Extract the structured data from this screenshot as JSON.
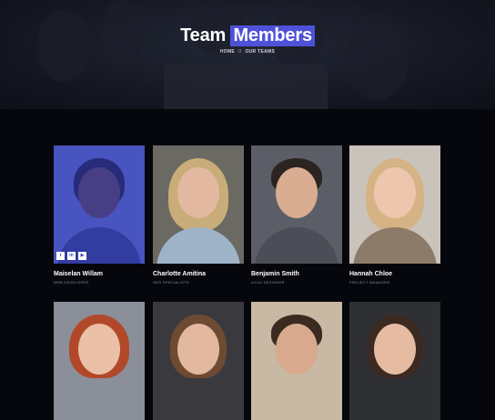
{
  "hero": {
    "title_a": "Team",
    "title_b": "Members",
    "breadcrumb_home": "HOME",
    "breadcrumb_sep": "//",
    "breadcrumb_current": "OUR TEAMS"
  },
  "team": [
    {
      "name": "Maiselan Willam",
      "role": "WEB DEVELOPER"
    },
    {
      "name": "Charlotte Amitina",
      "role": "SEO SPECIALISTS"
    },
    {
      "name": "Benjamin Smith",
      "role": "UX/UI DESIGNER"
    },
    {
      "name": "Hannah Chloe",
      "role": "PROJECT MANAGER"
    }
  ],
  "socials": {
    "twitter": "t",
    "linkedin": "in",
    "youtube": "▶"
  },
  "colors": {
    "accent": "#4f52d8",
    "background": "#06070d"
  }
}
